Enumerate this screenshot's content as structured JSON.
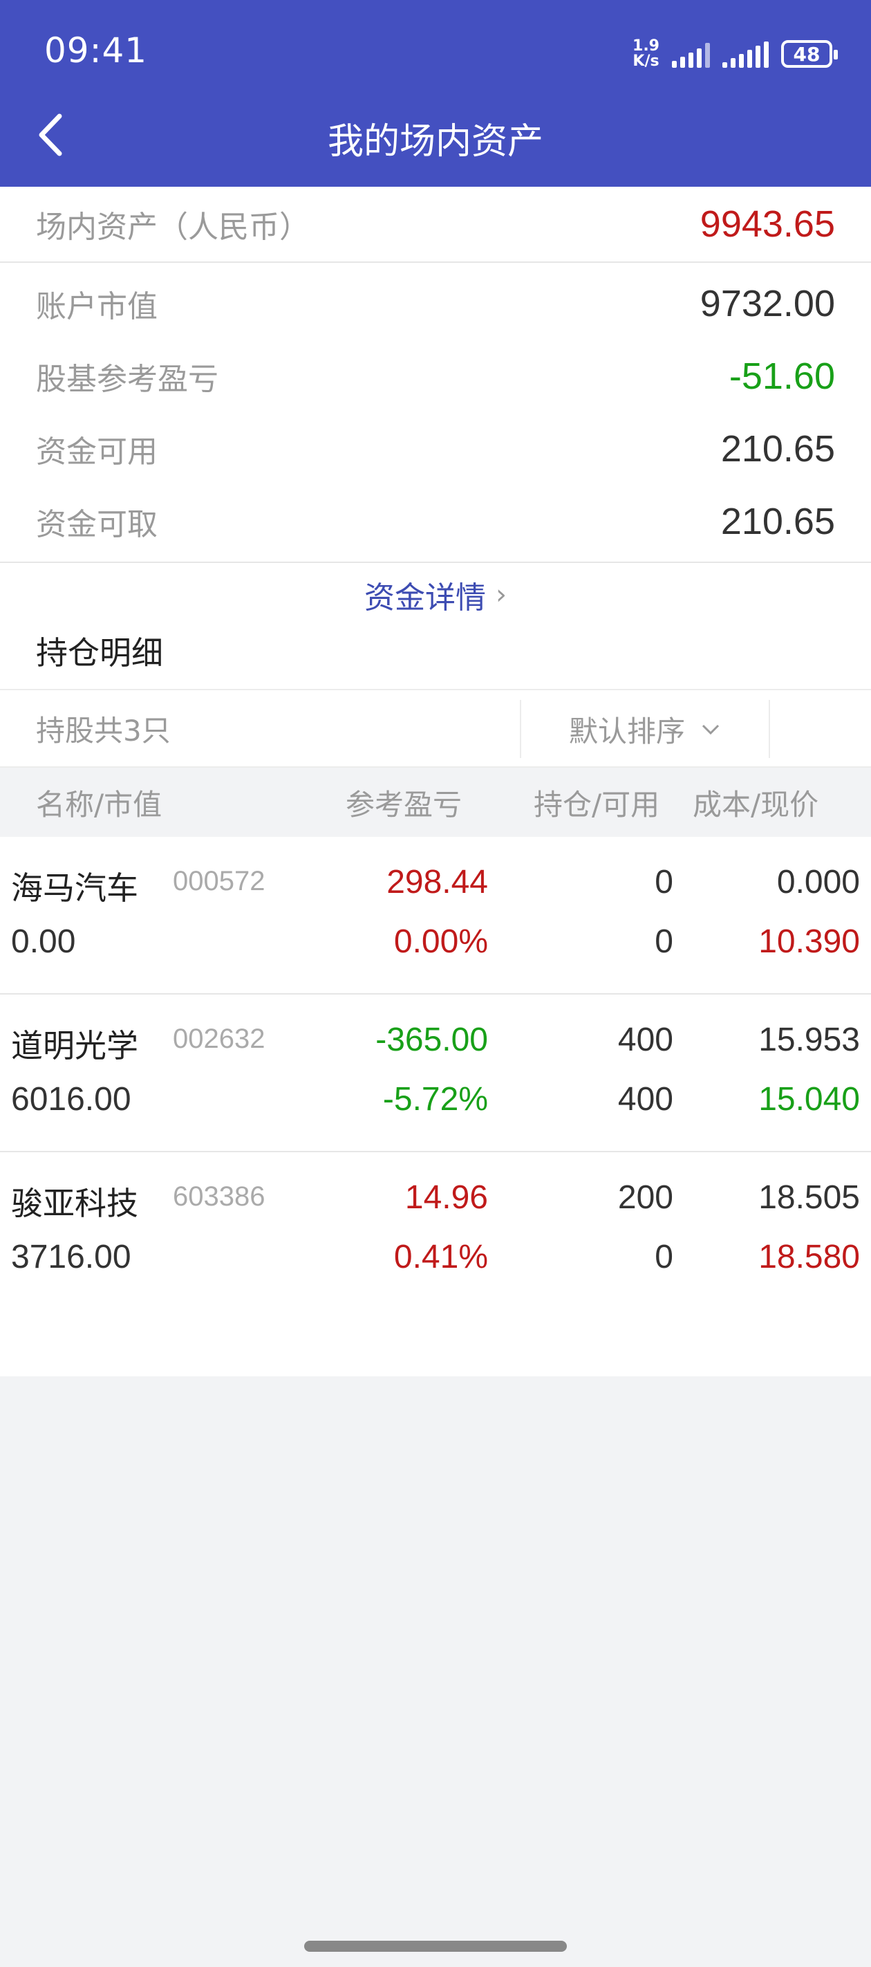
{
  "status": {
    "time": "09:41",
    "net_speed_top": "1.9",
    "net_speed_bottom": "K/s",
    "battery": "48"
  },
  "header": {
    "title": "我的场内资产"
  },
  "summary": {
    "total_label": "场内资产（人民币）",
    "total_value": "9943.65",
    "market_value_label": "账户市值",
    "market_value": "9732.00",
    "pnl_label": "股基参考盈亏",
    "pnl_value": "-51.60",
    "available_label": "资金可用",
    "available_value": "210.65",
    "withdrawable_label": "资金可取",
    "withdrawable_value": "210.65",
    "detail_link": "资金详情"
  },
  "holdings": {
    "title": "持仓明细",
    "count_text": "持股共3只",
    "sort_label": "默认排序",
    "columns": {
      "name": "名称/市值",
      "pnl": "参考盈亏",
      "position": "持仓/可用",
      "cost": "成本/现价"
    },
    "rows": [
      {
        "name": "海马汽车",
        "code": "000572",
        "market_value": "0.00",
        "pnl": "298.44",
        "pnl_pct": "0.00%",
        "position": "0",
        "available": "0",
        "cost": "0.000",
        "price": "10.390",
        "pnl_color": "red",
        "price_color": "red"
      },
      {
        "name": "道明光学",
        "code": "002632",
        "market_value": "6016.00",
        "pnl": "-365.00",
        "pnl_pct": "-5.72%",
        "position": "400",
        "available": "400",
        "cost": "15.953",
        "price": "15.040",
        "pnl_color": "green",
        "price_color": "green"
      },
      {
        "name": "骏亚科技",
        "code": "603386",
        "market_value": "3716.00",
        "pnl": "14.96",
        "pnl_pct": "0.41%",
        "position": "200",
        "available": "0",
        "cost": "18.505",
        "price": "18.580",
        "pnl_color": "red",
        "price_color": "red"
      }
    ]
  },
  "colors": {
    "header_bg": "#4450c0",
    "up_red": "#c01a1a",
    "down_green": "#18a018",
    "link_blue": "#3d4cb2"
  }
}
